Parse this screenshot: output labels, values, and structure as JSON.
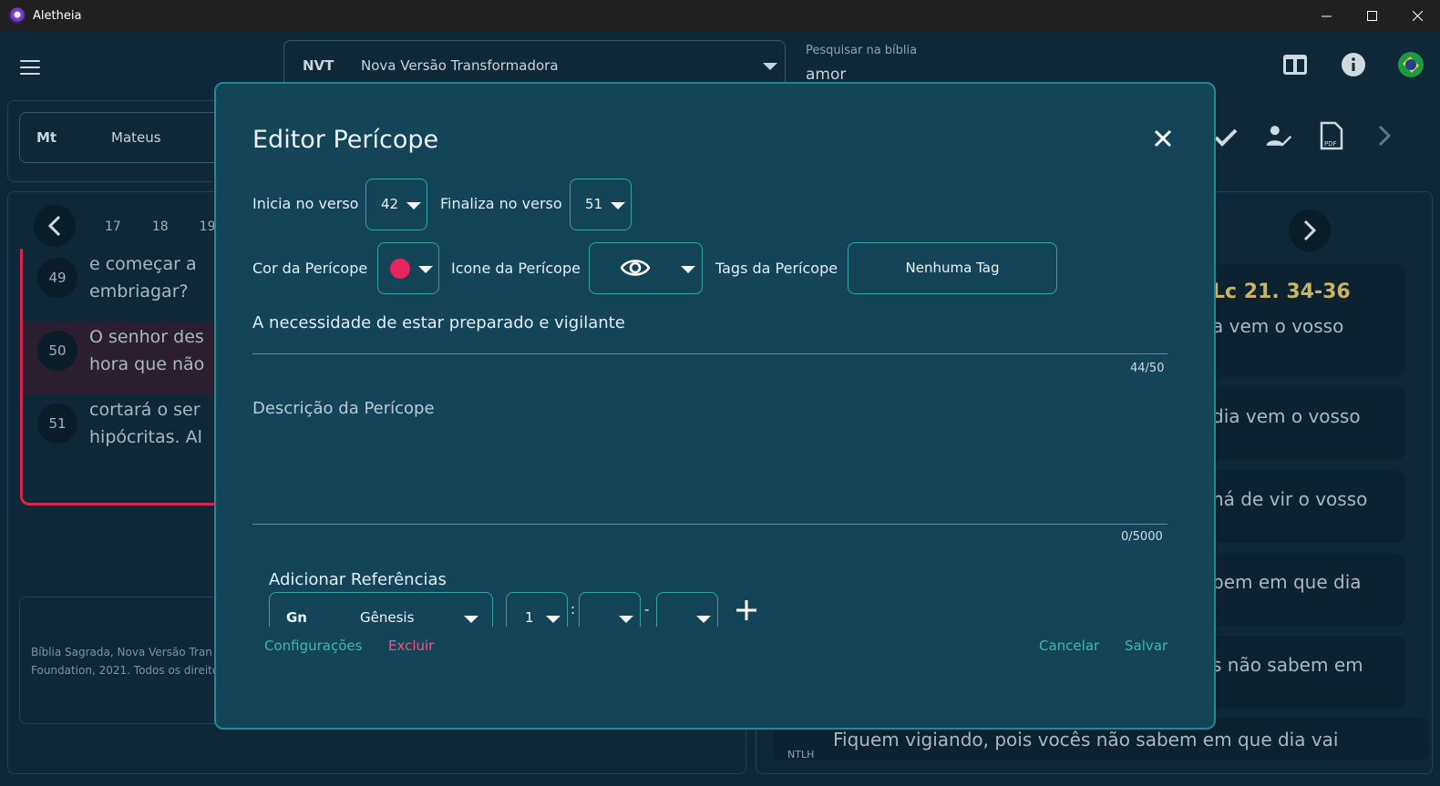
{
  "window": {
    "title": "Aletheia"
  },
  "header": {
    "version_abbr": "NVT",
    "version_name": "Nova Versão Transformadora",
    "search_label": "Pesquisar na bíblia",
    "search_value": "amor"
  },
  "book": {
    "abbr": "Mt",
    "name": "Mateus"
  },
  "chapters": [
    "17",
    "18",
    "19"
  ],
  "verses": [
    {
      "num": "49",
      "text": "e começar a\nembriagar?"
    },
    {
      "num": "50",
      "text": "O senhor des\nhora que não"
    },
    {
      "num": "51",
      "text": "cortará o ser\nhipócritas. Al"
    }
  ],
  "copyright": "Bíblia Sagrada, Nova Versão Tran\nFoundation, 2021. Todos os direito",
  "parallel": {
    "reference": "Lc 21. 34-36",
    "cards": [
      "a vem o vosso",
      "dia vem o vosso",
      "há de vir o vosso",
      "bem em que dia",
      "s não sabem em"
    ],
    "bottom_label": "NTLH",
    "bottom_text": "Fiquem vigiando, pois vocês não sabem em que dia vai"
  },
  "modal": {
    "title": "Editor Perícope",
    "start_label": "Inicia no verso",
    "start_value": "42",
    "end_label": "Finaliza no verso",
    "end_value": "51",
    "color_label": "Cor da Perícope",
    "color_value": "#e8245e",
    "icon_label": "Icone da Perícope",
    "icon_value": "eye-icon",
    "tags_label": "Tags da Perícope",
    "tags_value": "Nenhuma Tag",
    "pericope_title": "A necessidade de estar preparado e vigilante",
    "title_counter": "44/50",
    "description_placeholder": "Descrição da Perícope",
    "description_counter": "0/5000",
    "refs_label": "Adicionar Referências",
    "ref_book_abbr": "Gn",
    "ref_book_name": "Gênesis",
    "ref_chapter": "1",
    "ref_colon": ":",
    "ref_dash": "-",
    "settings_button": "Configurações",
    "delete_button": "Excluir",
    "cancel_button": "Cancelar",
    "save_button": "Salvar"
  }
}
